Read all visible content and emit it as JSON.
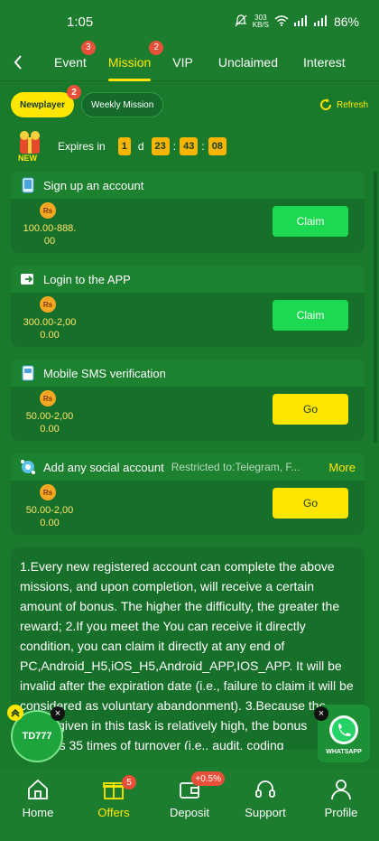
{
  "status": {
    "time": "1:05",
    "speed_value": "303",
    "speed_unit": "KB/S",
    "battery": "86%"
  },
  "tabs": [
    {
      "label": "Event",
      "badge": "3"
    },
    {
      "label": "Mission",
      "badge": "2"
    },
    {
      "label": "VIP"
    },
    {
      "label": "Unclaimed"
    },
    {
      "label": "Interest"
    }
  ],
  "subtabs": {
    "newplayer": {
      "label": "Newplayer",
      "badge": "2"
    },
    "weekly": {
      "label": "Weekly Mission"
    },
    "refresh": "Refresh"
  },
  "expires": {
    "label": "Expires in",
    "new_tag": "NEW",
    "days": "1",
    "d": "d",
    "hours": "23",
    "minutes": "43",
    "seconds": "08",
    "sep": ":"
  },
  "missions": [
    {
      "title": "Sign up an account",
      "coin": "Rs",
      "reward_1": "100.00-888.",
      "reward_2": "00",
      "button": "Claim"
    },
    {
      "title": "Login to the APP",
      "coin": "Rs",
      "reward_1": "300.00-2,00",
      "reward_2": "0.00",
      "button": "Claim"
    },
    {
      "title": "Mobile SMS verification",
      "coin": "Rs",
      "reward_1": "50.00-2,00",
      "reward_2": "0.00",
      "button": "Go"
    },
    {
      "title": "Add any social account",
      "restrict": "Restricted to:Telegram, F...",
      "more": "More",
      "coin": "Rs",
      "reward_1": "50.00-2,00",
      "reward_2": "0.00",
      "button": "Go"
    }
  ],
  "rules": {
    "text": "1.Every new registered account can complete the above missions, and upon completion, will receive a certain amount of bonus. The higher the difficulty, the greater the reward; 2.If you meet the You can receive it directly condition, you can claim it directly at any end of PC,Android_H5,iOS_H5,Android_APP,IOS_APP. It will be invalid after the expiration date (i.e., failure to claim it will be considered as voluntary abandonment). 3.Because the bonus given in this task is relatively high, the bonus requires 35 times of turnover (i.e., audit, coding"
  },
  "floating": {
    "td_label": "TD777",
    "close": "×",
    "whatsapp_label": "WHATSAPP"
  },
  "bottom_nav": [
    {
      "label": "Home"
    },
    {
      "label": "Offers",
      "badge": "5"
    },
    {
      "label": "Deposit",
      "badge": "+0.5%"
    },
    {
      "label": "Support"
    },
    {
      "label": "Profile"
    }
  ],
  "colors": {
    "background": "#1a7a2c",
    "accent": "#ffe600",
    "claim": "#1cd94f",
    "badge": "#e8503a"
  }
}
